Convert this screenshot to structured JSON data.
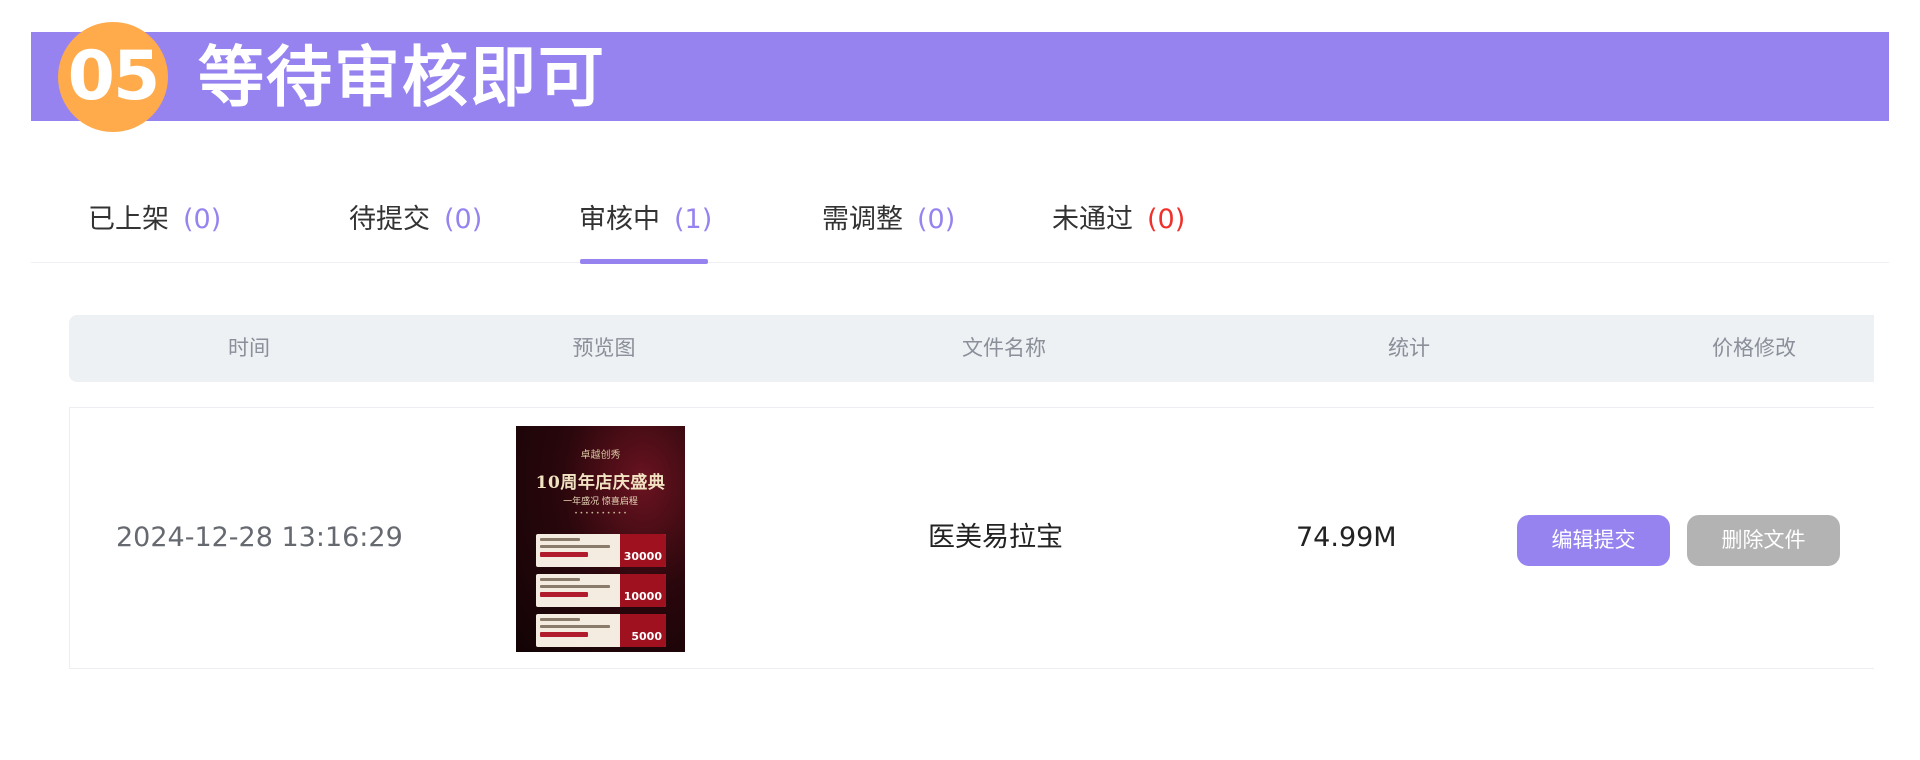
{
  "step": {
    "number": "05",
    "title": "等待审核即可"
  },
  "tabs": [
    {
      "label": "已上架",
      "count": "(0)"
    },
    {
      "label": "待提交",
      "count": "(0)"
    },
    {
      "label": "审核中",
      "count": "(1)",
      "active": true
    },
    {
      "label": "需调整",
      "count": "(0)"
    },
    {
      "label": "未通过",
      "count": "(0)"
    }
  ],
  "colors": {
    "accent": "#9683f0",
    "badge": "#ffab4b",
    "rejected_count": "#f0302a",
    "delete_button": "#b3b3b3"
  },
  "table": {
    "headers": {
      "time": "时间",
      "preview": "预览图",
      "filename": "文件名称",
      "stats": "统计",
      "price": "价格修改"
    },
    "rows": [
      {
        "time": "2024-12-28 13:16:29",
        "filename": "医美易拉宝",
        "stats": "74.99M",
        "preview": {
          "brand": "卓越创秀",
          "title": "10周年店庆盛典",
          "subtitle": "一年盛况 惊喜启程",
          "amounts": [
            "30000",
            "10000",
            "5000"
          ]
        },
        "actions": {
          "edit": "编辑提交",
          "delete": "删除文件"
        }
      }
    ]
  }
}
